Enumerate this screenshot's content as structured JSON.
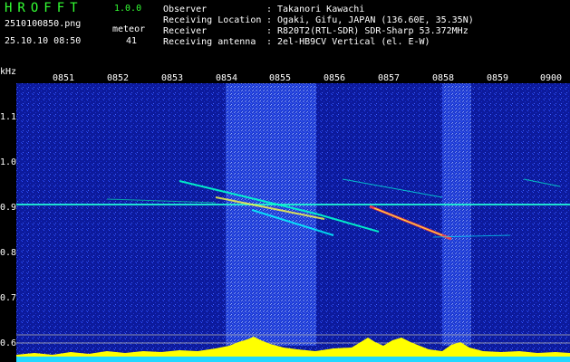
{
  "app": {
    "title": "HROFFT",
    "version": "1.0.0"
  },
  "file_name": "2510100850.png",
  "timestamp": "25.10.10 08:50",
  "meteor": {
    "label": "meteor",
    "count": "41"
  },
  "info": [
    {
      "label": "Observer",
      "value": "Takanori Kawachi"
    },
    {
      "label": "Receiving Location",
      "value": "Ogaki, Gifu, JAPAN (136.60E, 35.35N)"
    },
    {
      "label": "Receiver",
      "value": "R820T2(RTL-SDR) SDR-Sharp 53.372MHz"
    },
    {
      "label": "Receiving antenna",
      "value": "2el-HB9CV Vertical (el. E-W)"
    }
  ],
  "axis": {
    "unit": "kHz",
    "freq_ticks": [
      "1.1",
      "1.0",
      "0.9",
      "0.8",
      "0.7",
      "0.6"
    ],
    "time_ticks": [
      "0851",
      "0852",
      "0853",
      "0854",
      "0855",
      "0856",
      "0857",
      "0858",
      "0859",
      "0900"
    ]
  },
  "colors": {
    "background": "#0c1a9c",
    "header_green": "#33ff33",
    "signal_yellow": "#ffff00",
    "signal_cyan": "#00ffff",
    "signal_red": "#ff3030"
  }
}
